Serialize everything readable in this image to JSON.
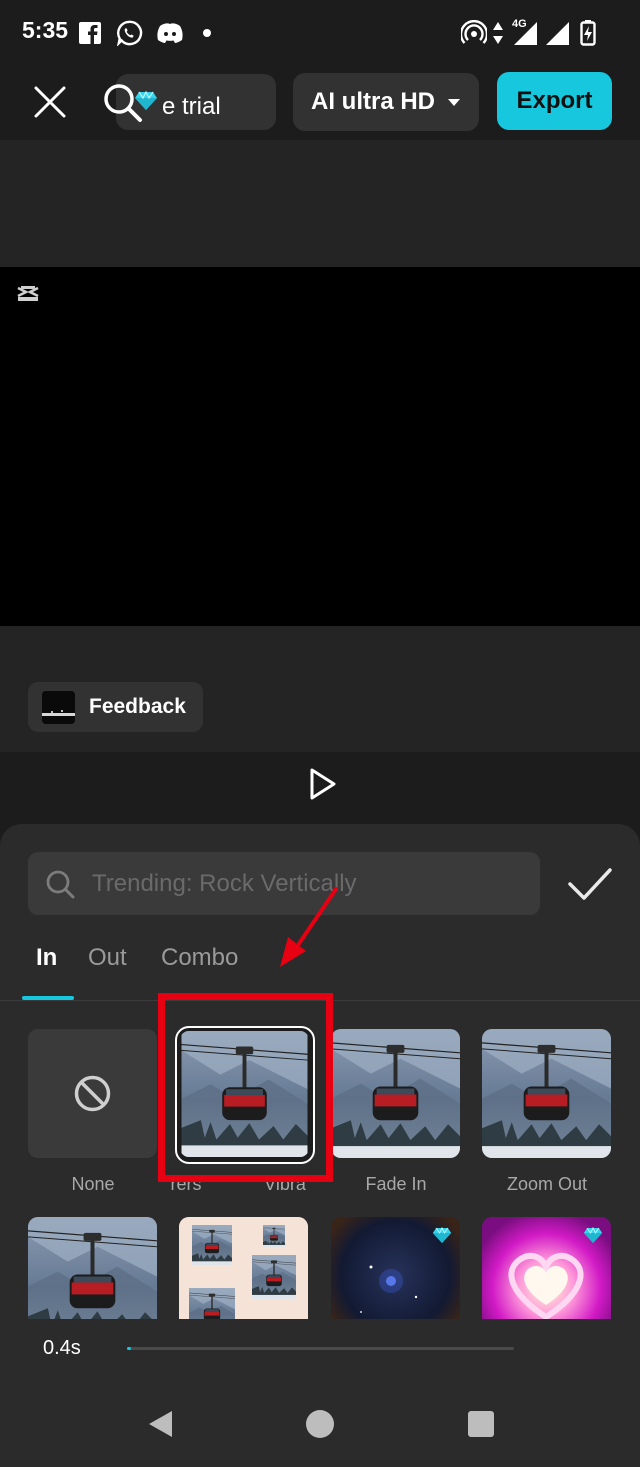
{
  "status_bar": {
    "time": "5:35",
    "left_icons": [
      "facebook-icon",
      "whatsapp-icon",
      "discord-icon",
      "notification-dot-icon"
    ],
    "network_label": "4G",
    "right_icons": [
      "hotspot-icon",
      "data-arrows-icon",
      "signal-icon",
      "signal-icon",
      "battery-charging-icon"
    ]
  },
  "top_bar": {
    "trial_text": "e trial",
    "quality_label": "AI ultra HD",
    "export_label": "Export"
  },
  "preview": {
    "feedback_label": "Feedback"
  },
  "animation_panel": {
    "search_placeholder": "Trending: Rock Vertically",
    "tabs": [
      {
        "label": "In",
        "active": true
      },
      {
        "label": "Out",
        "active": false
      },
      {
        "label": "Combo",
        "active": false
      }
    ],
    "row1_labels": [
      "None",
      "rers",
      "Vibra",
      "Fade In",
      "Zoom Out"
    ],
    "row2_premium": [
      false,
      false,
      true,
      true
    ],
    "duration_label": "0.4s",
    "duration_progress": 0.01
  },
  "colors": {
    "accent": "#16c7dd",
    "annotation": "#e60012",
    "background": "#1c1c1c",
    "panel": "#2b2b2b"
  }
}
